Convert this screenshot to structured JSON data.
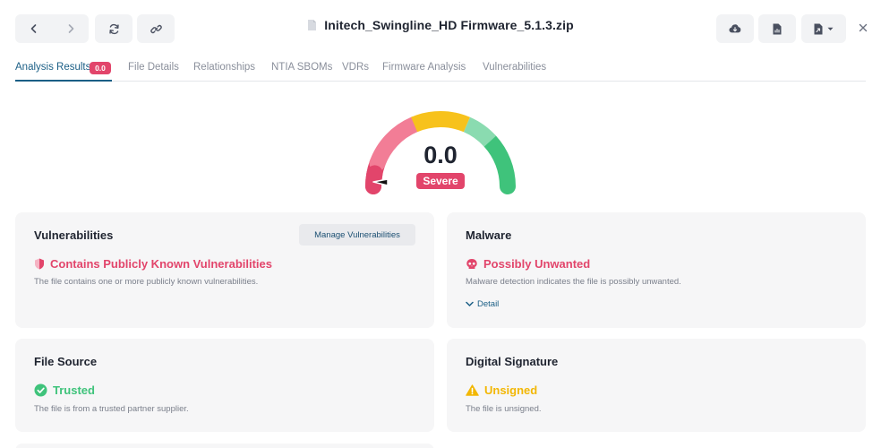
{
  "header": {
    "title": "Initech_Swingline_HD Firmware_5.1.3.zip",
    "file_icon": "file-icon",
    "nav": {
      "back_icon": "chevron-left-icon",
      "forward_icon": "chevron-right-icon"
    },
    "actions": [
      "refresh-icon",
      "link-icon",
      "cloud-download-icon",
      "file-report-icon",
      "file-export-icon",
      "close-icon"
    ]
  },
  "tabs": [
    {
      "label": "Analysis Results",
      "badge": "0.0",
      "active": true
    },
    {
      "label": "File Details"
    },
    {
      "label": "Relationships"
    },
    {
      "label": "NTIA SBOMs"
    },
    {
      "label": "VDRs"
    },
    {
      "label": "Firmware Analysis"
    },
    {
      "label": "Vulnerabilities"
    }
  ],
  "gauge": {
    "score": "0.0",
    "rating": "Severe",
    "score_value": 0.0,
    "colors": {
      "severe": "#e2456b",
      "high": "#f27d96",
      "medium": "#f7c21c",
      "low": "#8adbb0",
      "good": "#3fc37b"
    }
  },
  "cards": {
    "vulnerabilities": {
      "title": "Vulnerabilities",
      "button": "Manage Vulnerabilities",
      "status": "Contains Publicly Known Vulnerabilities",
      "status_color": "#e2456b",
      "icon": "shield-bug-icon",
      "description": "The file contains one or more publicly known vulnerabilities."
    },
    "malware": {
      "title": "Malware",
      "status": "Possibly Unwanted",
      "status_color": "#e2456b",
      "icon": "skull-icon",
      "description": "Malware detection indicates the file is possibly unwanted.",
      "detail": "Detail"
    },
    "file_source": {
      "title": "File Source",
      "status": "Trusted",
      "status_color": "#3fc37b",
      "icon": "check-circle-icon",
      "description": "The file is from a trusted partner supplier."
    },
    "digital_signature": {
      "title": "Digital Signature",
      "status": "Unsigned",
      "status_color": "#f2b705",
      "icon": "warning-icon",
      "description": "The file is unsigned."
    }
  }
}
